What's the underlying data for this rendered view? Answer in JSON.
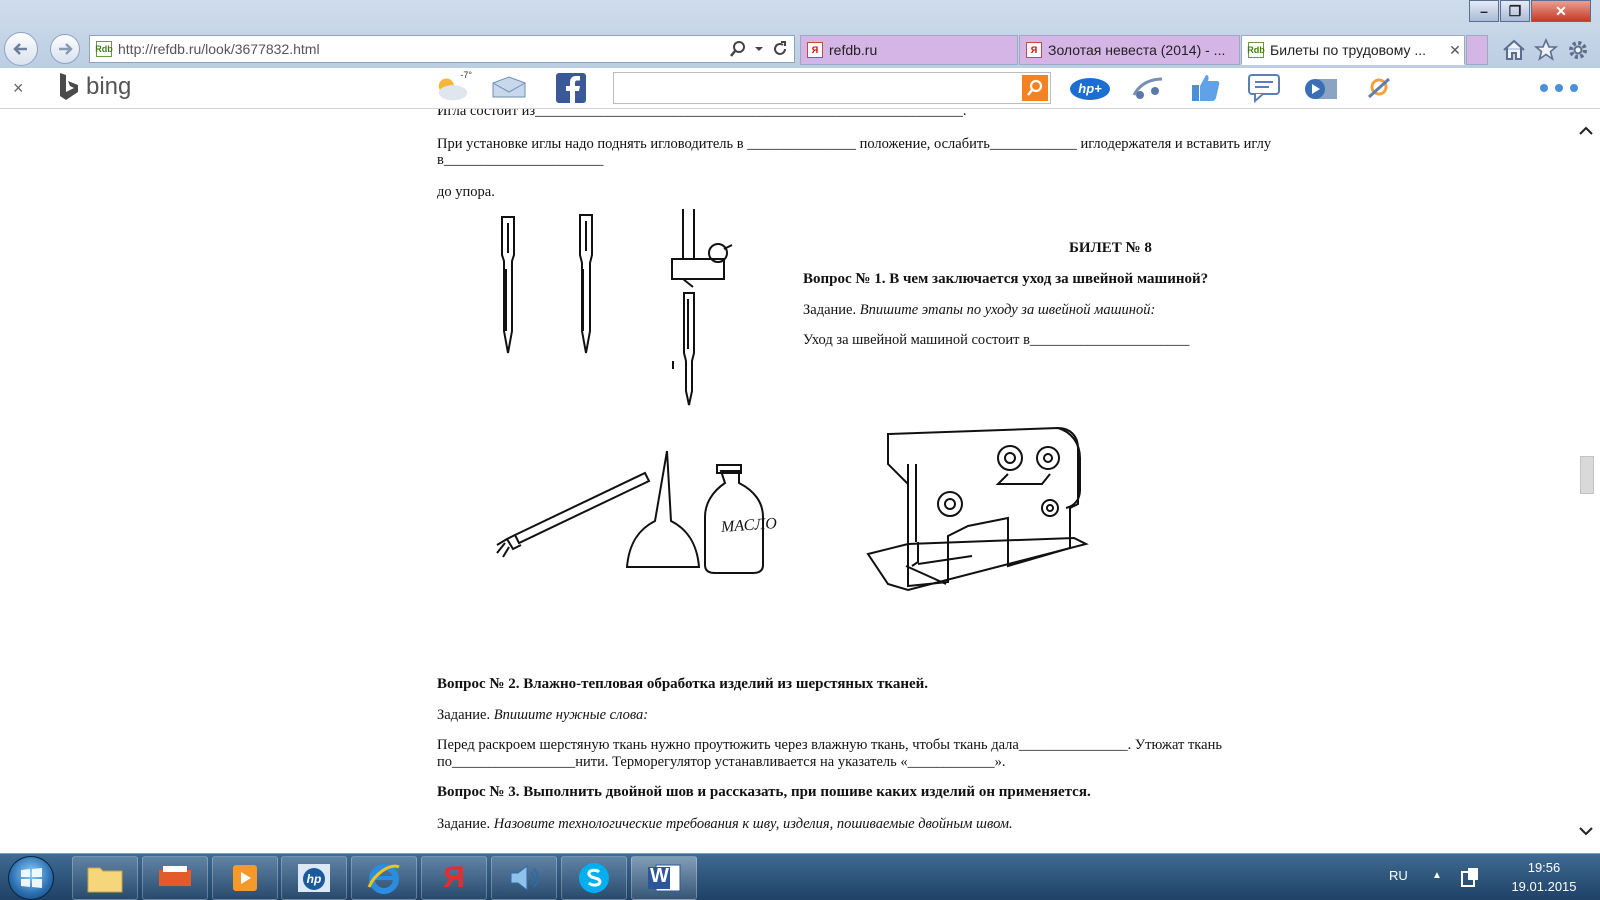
{
  "browser": {
    "url": "http://refdb.ru/look/3677832.html",
    "tabs": [
      {
        "label": "refdb.ru",
        "favicon": "yandex-favicon"
      },
      {
        "label": "Золотая невеста (2014) - ...",
        "favicon": "yandex-favicon"
      },
      {
        "label": "Билеты по трудовому ...",
        "favicon": "refdb-favicon",
        "active": true
      }
    ],
    "favicon_text": "Rdb",
    "yandex_favicon_text": "Я",
    "window_controls": {
      "minimize": "–",
      "maximize": "❐",
      "close": "✕"
    }
  },
  "bingbar": {
    "close": "×",
    "logo": "bing",
    "weather": "-7°",
    "search_value": "",
    "hp_label": "hp+"
  },
  "document": {
    "line_needle_parts": "Игла состоит из___________________________________________________________.",
    "line_install_1": "При установке иглы надо поднять игловодитель в _______________ положение, ослабить____________ иглодержателя и вставить иглу",
    "line_install_2": "в______________________",
    "line_install_3": "до упора.",
    "ticket_title": "БИЛЕТ № 8",
    "q1": "Вопрос № 1. В чем заключается уход за швейной машиной?",
    "q1_task_label": "Задание.",
    "q1_task_text": "Впишите этапы по уходу за швейной машиной:",
    "q1_line": "Уход за швейной машиной состоит в______________________",
    "oil_label": "МАСЛО",
    "q2": "Вопрос № 2. Влажно-тепловая обработка изделий из шерстяных тканей.",
    "q2_task_label": "Задание.",
    "q2_task_text": "Впишите нужные слова:",
    "q2_line_1": "Перед раскроем шерстяную ткань нужно проутюжить через влажную ткань, чтобы ткань дала_______________. Утюжат ткань",
    "q2_line_2": "по_________________нити. Терморегулятор устанавливается на указатель «____________».",
    "q3": "Вопрос № 3. Выполнить двойной шов и рассказать, при пошиве каких изделий он применяется.",
    "q3_task_label": "Задание.",
    "q3_task_text": "Назовите технологические требования к шву, изделия, пошиваемые двойным швом."
  },
  "taskbar": {
    "language": "RU",
    "time": "19:56",
    "date": "19.01.2015",
    "yandex_letter": "Я",
    "word_letter": "W",
    "hp_text": "hp"
  },
  "colors": {
    "titlebar": "#c5d5ea",
    "tab_purple": "#d5b4e6",
    "bing_orange": "#f58220",
    "taskbar": "#2c5479"
  }
}
